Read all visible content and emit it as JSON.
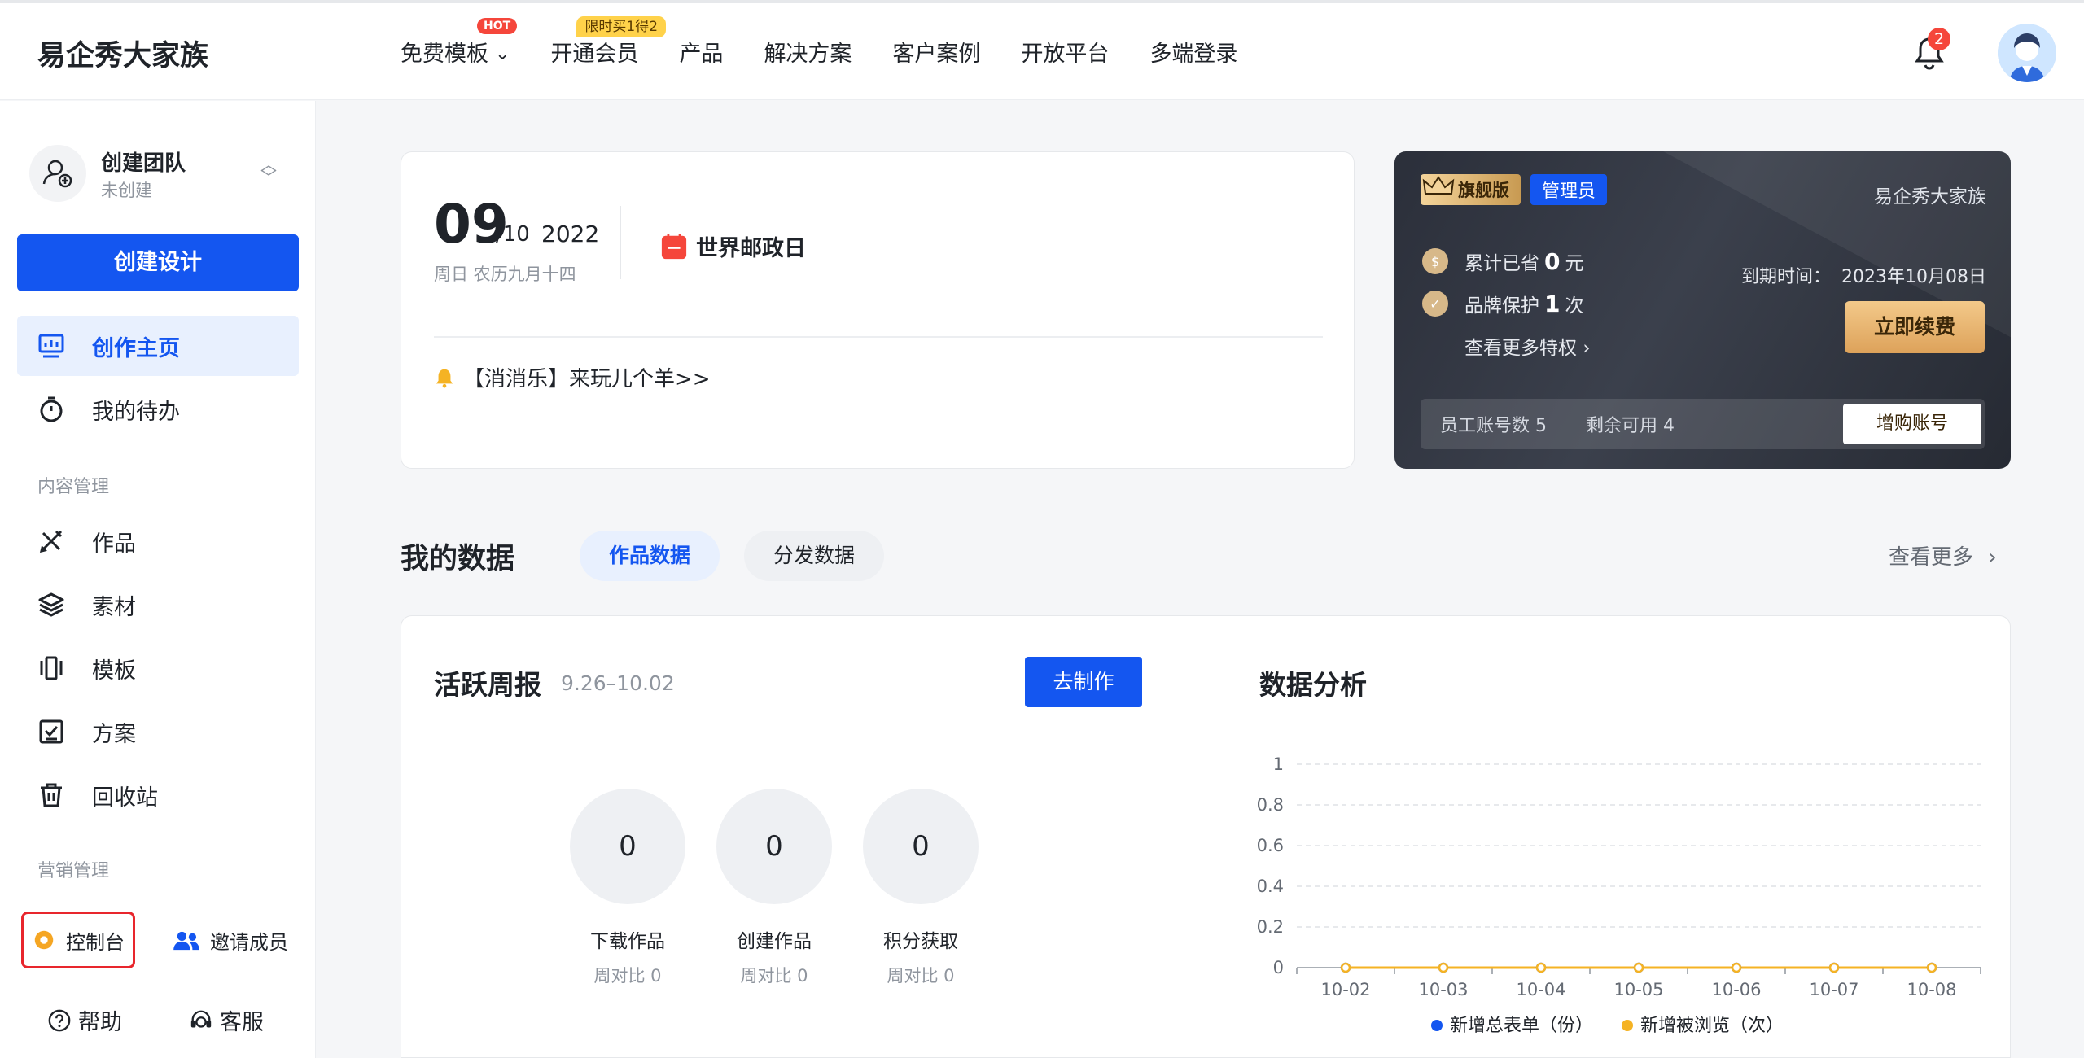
{
  "brand": "易企秀大家族",
  "nav": [
    {
      "label": "免费模板",
      "badge": "HOT"
    },
    {
      "label": "开通会员",
      "badge": "限时买1得2"
    },
    {
      "label": "产品"
    },
    {
      "label": "解决方案"
    },
    {
      "label": "客户案例"
    },
    {
      "label": "开放平台"
    },
    {
      "label": "多端登录"
    }
  ],
  "notifications": {
    "count": "2"
  },
  "sidebar": {
    "team_name": "创建团队",
    "team_status": "未创建",
    "create_label": "创建设计",
    "items": [
      {
        "label": "创作主页"
      },
      {
        "label": "我的待办"
      },
      {
        "label": "作品"
      },
      {
        "label": "素材"
      },
      {
        "label": "模板"
      },
      {
        "label": "方案"
      },
      {
        "label": "回收站"
      }
    ],
    "section_content": "内容管理",
    "section_marketing": "营销管理",
    "console": "控制台",
    "invite": "邀请成员",
    "help": "帮助",
    "service": "客服"
  },
  "date_card": {
    "day": "09",
    "month": "/10",
    "year": "2022",
    "lunar": "周日 农历九月十四",
    "holiday": "世界邮政日",
    "notice": "【消消乐】来玩儿个羊>>"
  },
  "vip": {
    "level": "旗舰版",
    "role": "管理员",
    "brand": "易企秀大家族",
    "saved_prefix": "累计已省",
    "saved_value": "0",
    "saved_unit": "元",
    "protect_prefix": "品牌保护",
    "protect_value": "1",
    "protect_unit": "次",
    "more": "查看更多特权",
    "expire_label": "到期时间：",
    "expire_date": "2023年10月08日",
    "renew": "立即续费",
    "seats": "员工账号数 5",
    "remaining": "剩余可用 4",
    "buy": "增购账号"
  },
  "my_data": {
    "title": "我的数据",
    "tab_works": "作品数据",
    "tab_distribution": "分发数据",
    "see_more": "查看更多"
  },
  "weekly": {
    "title": "活跃周报",
    "range": "9.26–10.02",
    "go": "去制作",
    "stats": [
      {
        "value": "0",
        "label": "下载作品",
        "compare": "周对比 0"
      },
      {
        "value": "0",
        "label": "创建作品",
        "compare": "周对比 0"
      },
      {
        "value": "0",
        "label": "积分获取",
        "compare": "周对比 0"
      }
    ]
  },
  "analysis": {
    "title": "数据分析"
  },
  "colors": {
    "primary": "#1456f0",
    "series_orange": "#f5b324"
  },
  "chart_data": {
    "type": "line",
    "title": "",
    "categories": [
      "10-02",
      "10-03",
      "10-04",
      "10-05",
      "10-06",
      "10-07",
      "10-08"
    ],
    "series": [
      {
        "name": "新增总表单（份）",
        "color": "#1456f0",
        "values": [
          0,
          0,
          0,
          0,
          0,
          0,
          0
        ]
      },
      {
        "name": "新增被浏览（次）",
        "color": "#f5b324",
        "values": [
          0,
          0,
          0,
          0,
          0,
          0,
          0
        ]
      }
    ],
    "yticks": [
      "0",
      "0.2",
      "0.4",
      "0.6",
      "0.8",
      "1"
    ],
    "ylim": [
      0,
      1
    ],
    "grid": true,
    "legend": "bottom-center"
  }
}
